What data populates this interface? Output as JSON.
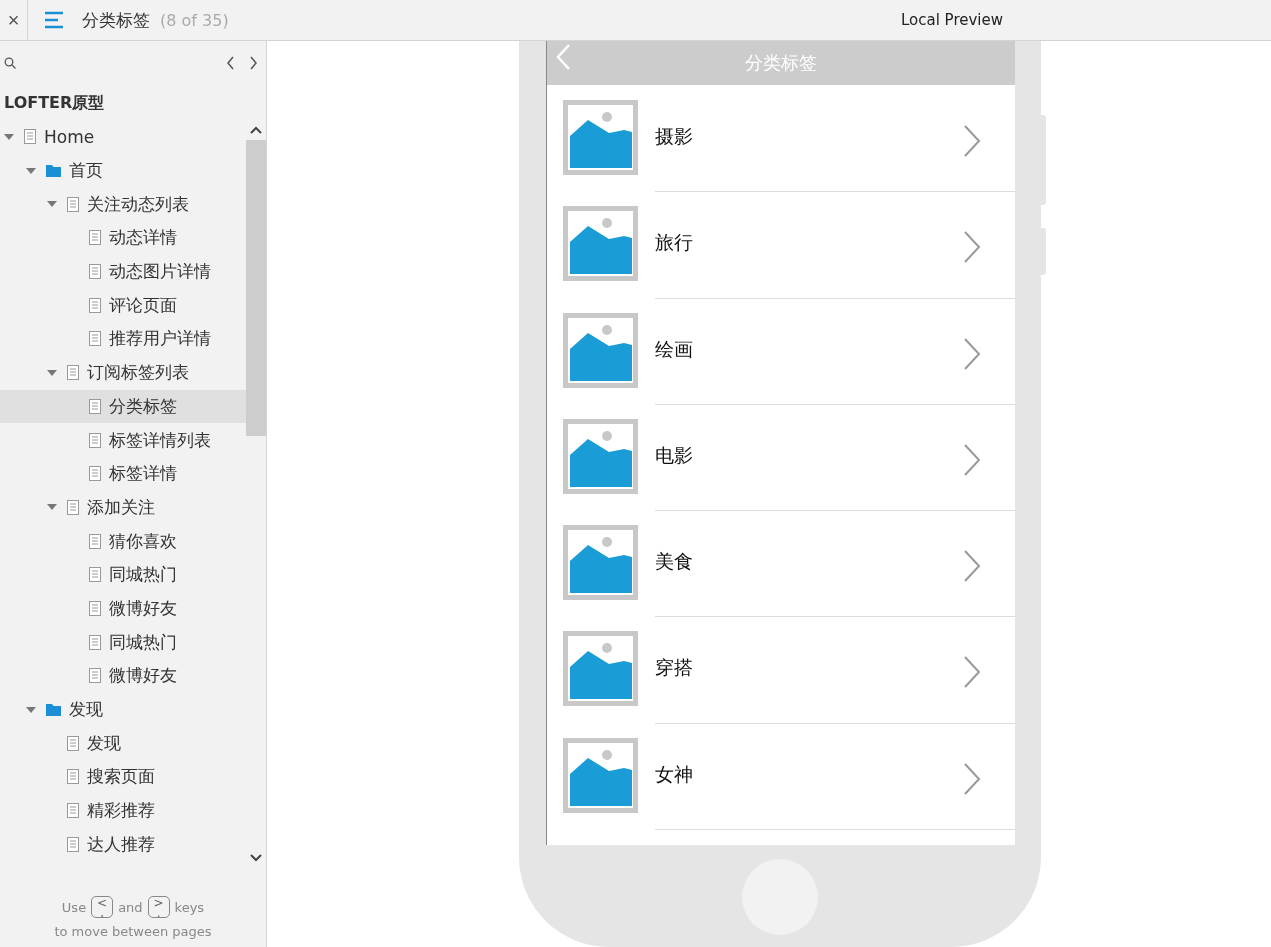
{
  "topbar": {
    "close": "×",
    "title": "分类标签",
    "count": "(8 of 35)",
    "preview": "Local Preview"
  },
  "sidebar": {
    "project": "LOFTER原型",
    "tree": [
      {
        "label": "Home",
        "kind": "page",
        "expanded": true,
        "selected": false,
        "children": [
          {
            "label": "首页",
            "kind": "folder",
            "expanded": true,
            "selected": false,
            "children": [
              {
                "label": "关注动态列表",
                "kind": "page",
                "expanded": true,
                "selected": false,
                "children": [
                  {
                    "label": "动态详情",
                    "kind": "page",
                    "selected": false
                  },
                  {
                    "label": "动态图片详情",
                    "kind": "page",
                    "selected": false
                  },
                  {
                    "label": "评论页面",
                    "kind": "page",
                    "selected": false
                  },
                  {
                    "label": "推荐用户详情",
                    "kind": "page",
                    "selected": false
                  }
                ]
              },
              {
                "label": "订阅标签列表",
                "kind": "page",
                "expanded": true,
                "selected": false,
                "children": [
                  {
                    "label": "分类标签",
                    "kind": "page",
                    "selected": true
                  },
                  {
                    "label": "标签详情列表",
                    "kind": "page",
                    "selected": false
                  },
                  {
                    "label": "标签详情",
                    "kind": "page",
                    "selected": false
                  }
                ]
              },
              {
                "label": "添加关注",
                "kind": "page",
                "expanded": true,
                "selected": false,
                "children": [
                  {
                    "label": "猜你喜欢",
                    "kind": "page",
                    "selected": false
                  },
                  {
                    "label": "同城热门",
                    "kind": "page",
                    "selected": false
                  },
                  {
                    "label": "微博好友",
                    "kind": "page",
                    "selected": false
                  },
                  {
                    "label": "同城热门",
                    "kind": "page",
                    "selected": false
                  },
                  {
                    "label": "微博好友",
                    "kind": "page",
                    "selected": false
                  }
                ]
              }
            ]
          },
          {
            "label": "发现",
            "kind": "folder",
            "expanded": true,
            "selected": false,
            "children": [
              {
                "label": "发现",
                "kind": "page",
                "selected": false
              },
              {
                "label": "搜索页面",
                "kind": "page",
                "selected": false
              },
              {
                "label": "精彩推荐",
                "kind": "page",
                "selected": false
              },
              {
                "label": "达人推荐",
                "kind": "page",
                "selected": false
              }
            ]
          }
        ]
      }
    ],
    "hint": {
      "words": [
        "Use",
        "and",
        "keys"
      ],
      "keys": [
        {
          "top": "<",
          "bottom": ","
        },
        {
          "top": ">",
          "bottom": "."
        }
      ],
      "line2": "to move between pages"
    }
  },
  "phone": {
    "title": "分类标签",
    "items": [
      {
        "label": "摄影"
      },
      {
        "label": "旅行"
      },
      {
        "label": "绘画"
      },
      {
        "label": "电影"
      },
      {
        "label": "美食"
      },
      {
        "label": "穿搭"
      },
      {
        "label": "女神"
      }
    ]
  }
}
